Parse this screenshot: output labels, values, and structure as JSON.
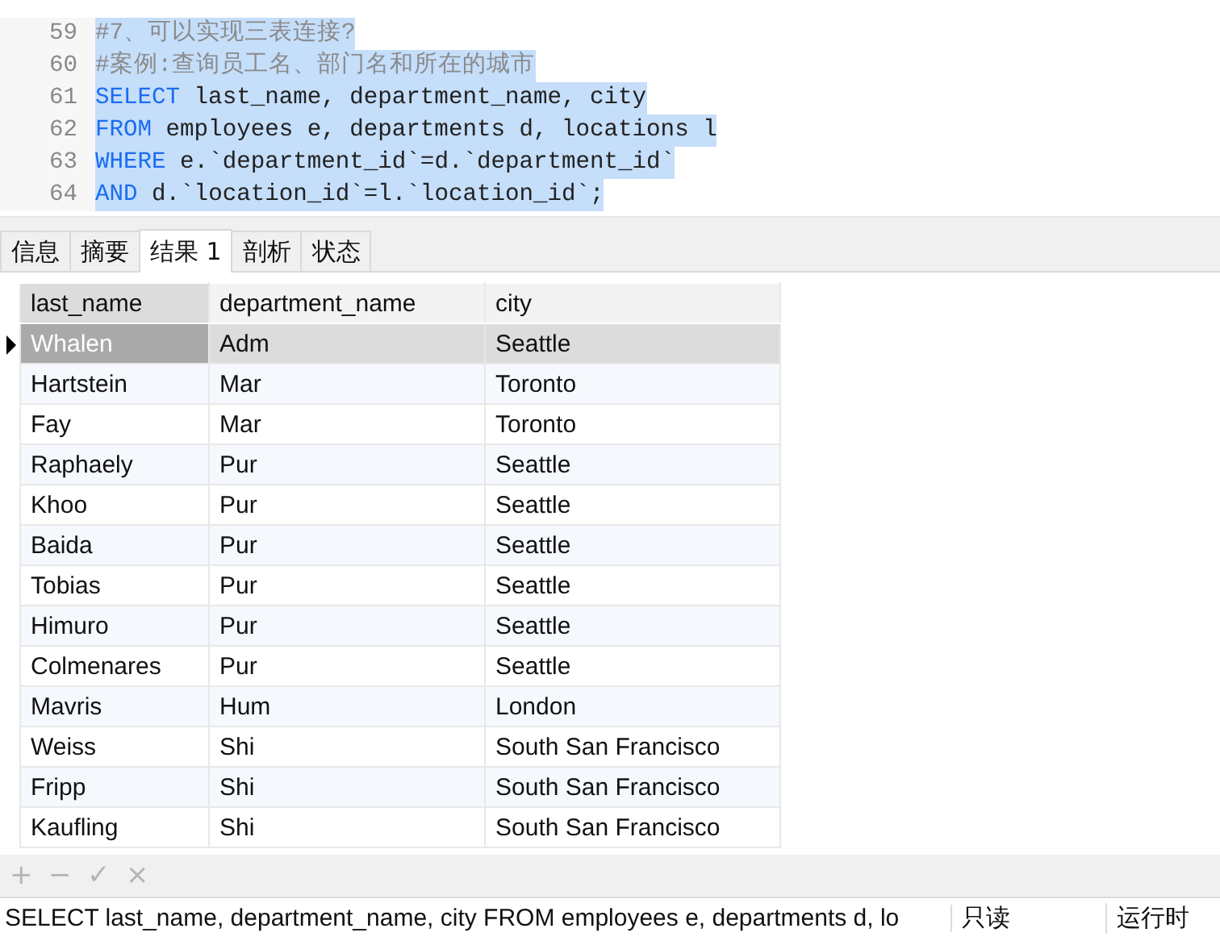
{
  "editor": {
    "lines": [
      {
        "number": "59",
        "selected": true,
        "segments": [
          {
            "kind": "comment",
            "text": "#7、可以实现三表连接?"
          }
        ]
      },
      {
        "number": "60",
        "selected": true,
        "segments": [
          {
            "kind": "comment",
            "text": "#案例:查询员工名、部门名和所在的城市"
          }
        ]
      },
      {
        "number": "61",
        "selected": true,
        "segments": [
          {
            "kind": "keyword",
            "text": "SELECT"
          },
          {
            "kind": "plain",
            "text": " last_name, department_name, city"
          }
        ]
      },
      {
        "number": "62",
        "selected": true,
        "segments": [
          {
            "kind": "keyword",
            "text": "FROM"
          },
          {
            "kind": "plain",
            "text": " employees e, departments d, locations l"
          }
        ]
      },
      {
        "number": "63",
        "selected": true,
        "segments": [
          {
            "kind": "keyword",
            "text": "WHERE"
          },
          {
            "kind": "plain",
            "text": " e.`department_id`=d.`department_id`"
          }
        ]
      },
      {
        "number": "64",
        "selected": true,
        "segments": [
          {
            "kind": "keyword",
            "text": "AND"
          },
          {
            "kind": "plain",
            "text": " d.`location_id`=l.`location_id`;"
          }
        ]
      }
    ]
  },
  "tabs": [
    {
      "label": "信息",
      "selected": false
    },
    {
      "label": "摘要",
      "selected": false
    },
    {
      "label": "结果 1",
      "selected": true
    },
    {
      "label": "剖析",
      "selected": false
    },
    {
      "label": "状态",
      "selected": false
    }
  ],
  "table": {
    "columns": [
      "last_name",
      "department_name",
      "city"
    ],
    "rows": [
      {
        "selected": true,
        "cells": [
          "Whalen",
          "Adm",
          "Seattle"
        ]
      },
      {
        "selected": false,
        "cells": [
          "Hartstein",
          "Mar",
          "Toronto"
        ]
      },
      {
        "selected": false,
        "cells": [
          "Fay",
          "Mar",
          "Toronto"
        ]
      },
      {
        "selected": false,
        "cells": [
          "Raphaely",
          "Pur",
          "Seattle"
        ]
      },
      {
        "selected": false,
        "cells": [
          "Khoo",
          "Pur",
          "Seattle"
        ]
      },
      {
        "selected": false,
        "cells": [
          "Baida",
          "Pur",
          "Seattle"
        ]
      },
      {
        "selected": false,
        "cells": [
          "Tobias",
          "Pur",
          "Seattle"
        ]
      },
      {
        "selected": false,
        "cells": [
          "Himuro",
          "Pur",
          "Seattle"
        ]
      },
      {
        "selected": false,
        "cells": [
          "Colmenares",
          "Pur",
          "Seattle"
        ]
      },
      {
        "selected": false,
        "cells": [
          "Mavris",
          "Hum",
          "London"
        ]
      },
      {
        "selected": false,
        "cells": [
          "Weiss",
          "Shi",
          "South San Francisco"
        ]
      },
      {
        "selected": false,
        "cells": [
          "Fripp",
          "Shi",
          "South San Francisco"
        ]
      },
      {
        "selected": false,
        "cells": [
          "Kaufling",
          "Shi",
          "South San Francisco"
        ]
      }
    ]
  },
  "toolbar": [
    {
      "label": "+"
    },
    {
      "label": "−"
    },
    {
      "label": "✓"
    },
    {
      "label": "×"
    }
  ],
  "status_bar": {
    "query": "SELECT last_name, department_name, city FROM employees e, departments d, lo",
    "mode": "只读",
    "runtime": "运行时"
  }
}
